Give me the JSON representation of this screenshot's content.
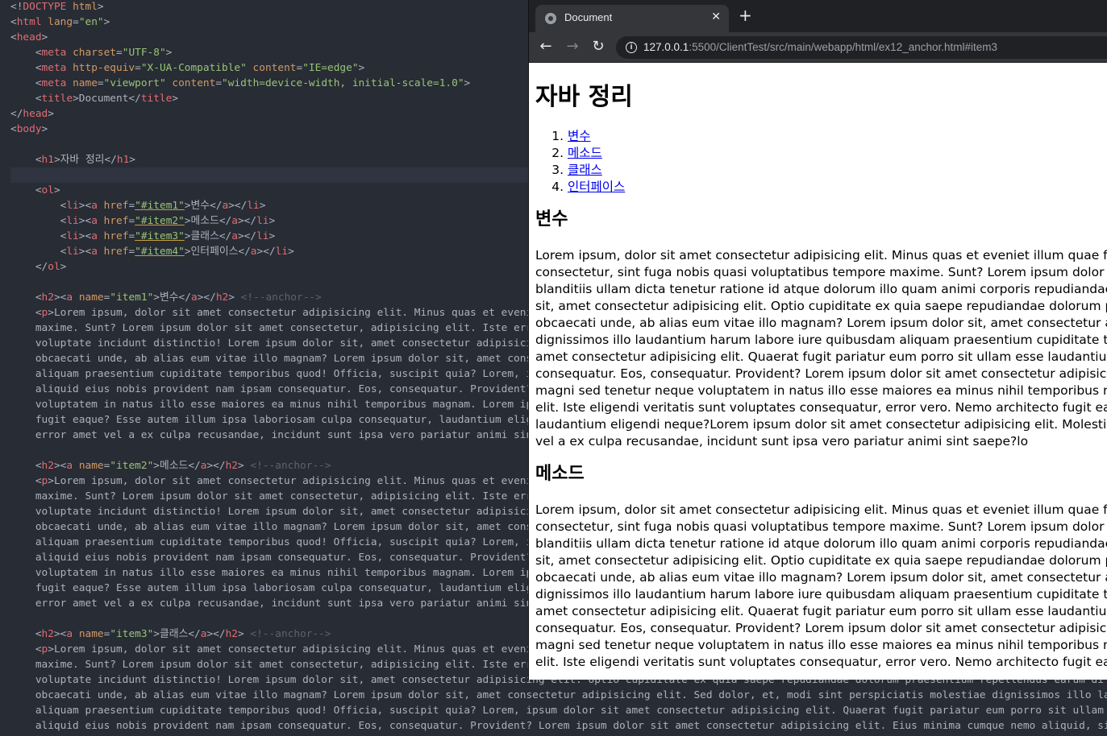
{
  "editor": {
    "lines": [
      [
        [
          "p",
          "<!"
        ],
        [
          "t",
          "DOCTYPE"
        ],
        [
          "p",
          " "
        ],
        [
          "a",
          "html"
        ],
        [
          "p",
          ">"
        ]
      ],
      [
        [
          "p",
          "<"
        ],
        [
          "t",
          "html"
        ],
        [
          "p",
          " "
        ],
        [
          "a",
          "lang"
        ],
        [
          "p",
          "="
        ],
        [
          "s",
          "\"en\""
        ],
        [
          "p",
          ">"
        ]
      ],
      [
        [
          "p",
          "<"
        ],
        [
          "t",
          "head"
        ],
        [
          "p",
          ">"
        ]
      ],
      [
        [
          "p",
          "    <"
        ],
        [
          "t",
          "meta"
        ],
        [
          "p",
          " "
        ],
        [
          "a",
          "charset"
        ],
        [
          "p",
          "="
        ],
        [
          "s",
          "\"UTF-8\""
        ],
        [
          "p",
          ">"
        ]
      ],
      [
        [
          "p",
          "    <"
        ],
        [
          "t",
          "meta"
        ],
        [
          "p",
          " "
        ],
        [
          "a",
          "http-equiv"
        ],
        [
          "p",
          "="
        ],
        [
          "s",
          "\"X-UA-Compatible\""
        ],
        [
          "p",
          " "
        ],
        [
          "a",
          "content"
        ],
        [
          "p",
          "="
        ],
        [
          "s",
          "\"IE=edge\""
        ],
        [
          "p",
          ">"
        ]
      ],
      [
        [
          "p",
          "    <"
        ],
        [
          "t",
          "meta"
        ],
        [
          "p",
          " "
        ],
        [
          "a",
          "name"
        ],
        [
          "p",
          "="
        ],
        [
          "s",
          "\"viewport\""
        ],
        [
          "p",
          " "
        ],
        [
          "a",
          "content"
        ],
        [
          "p",
          "="
        ],
        [
          "s",
          "\"width=device-width, initial-scale=1.0\""
        ],
        [
          "p",
          ">"
        ]
      ],
      [
        [
          "p",
          "    <"
        ],
        [
          "t",
          "title"
        ],
        [
          "p",
          ">Document</"
        ],
        [
          "t",
          "title"
        ],
        [
          "p",
          ">"
        ]
      ],
      [
        [
          "p",
          "</"
        ],
        [
          "t",
          "head"
        ],
        [
          "p",
          ">"
        ]
      ],
      [
        [
          "p",
          "<"
        ],
        [
          "t",
          "body"
        ],
        [
          "p",
          ">"
        ]
      ],
      [
        [
          "p",
          ""
        ]
      ],
      [
        [
          "p",
          "    <"
        ],
        [
          "t",
          "h1"
        ],
        [
          "p",
          ">자바 정리</"
        ],
        [
          "t",
          "h1"
        ],
        [
          "p",
          ">"
        ]
      ],
      [
        [
          "p",
          ""
        ]
      ],
      [
        [
          "p",
          "    <"
        ],
        [
          "t",
          "ol"
        ],
        [
          "p",
          ">"
        ]
      ],
      [
        [
          "p",
          "        <"
        ],
        [
          "t",
          "li"
        ],
        [
          "p",
          "><"
        ],
        [
          "t",
          "a"
        ],
        [
          "p",
          " "
        ],
        [
          "a",
          "href"
        ],
        [
          "p",
          "="
        ],
        [
          "s",
          "\"#item1\""
        ],
        [
          "p",
          ">변수</"
        ],
        [
          "t",
          "a"
        ],
        [
          "p",
          "></"
        ],
        [
          "t",
          "li"
        ],
        [
          "p",
          ">"
        ]
      ],
      [
        [
          "p",
          "        <"
        ],
        [
          "t",
          "li"
        ],
        [
          "p",
          "><"
        ],
        [
          "t",
          "a"
        ],
        [
          "p",
          " "
        ],
        [
          "a",
          "href"
        ],
        [
          "p",
          "="
        ],
        [
          "s",
          "\"#item2\""
        ],
        [
          "p",
          ">메소드</"
        ],
        [
          "t",
          "a"
        ],
        [
          "p",
          "></"
        ],
        [
          "t",
          "li"
        ],
        [
          "p",
          ">"
        ]
      ],
      [
        [
          "p",
          "        <"
        ],
        [
          "t",
          "li"
        ],
        [
          "p",
          "><"
        ],
        [
          "t",
          "a"
        ],
        [
          "p",
          " "
        ],
        [
          "a",
          "href"
        ],
        [
          "p",
          "="
        ],
        [
          "s",
          "\"#item3\""
        ],
        [
          "p",
          ">클래스</"
        ],
        [
          "t",
          "a"
        ],
        [
          "p",
          "></"
        ],
        [
          "t",
          "li"
        ],
        [
          "p",
          ">"
        ]
      ],
      [
        [
          "p",
          "        <"
        ],
        [
          "t",
          "li"
        ],
        [
          "p",
          "><"
        ],
        [
          "t",
          "a"
        ],
        [
          "p",
          " "
        ],
        [
          "a",
          "href"
        ],
        [
          "p",
          "="
        ],
        [
          "s",
          "\"#item4\""
        ],
        [
          "p",
          ">인터페이스</"
        ],
        [
          "t",
          "a"
        ],
        [
          "p",
          "></"
        ],
        [
          "t",
          "li"
        ],
        [
          "p",
          ">"
        ]
      ],
      [
        [
          "p",
          "    </"
        ],
        [
          "t",
          "ol"
        ],
        [
          "p",
          ">"
        ]
      ],
      [
        [
          "p",
          ""
        ]
      ],
      [
        [
          "p",
          "    <"
        ],
        [
          "t",
          "h2"
        ],
        [
          "p",
          "><"
        ],
        [
          "t",
          "a"
        ],
        [
          "p",
          " "
        ],
        [
          "a",
          "name"
        ],
        [
          "p",
          "="
        ],
        [
          "s",
          "\"item1\""
        ],
        [
          "p",
          ">변수</"
        ],
        [
          "t",
          "a"
        ],
        [
          "p",
          "></"
        ],
        [
          "t",
          "h2"
        ],
        [
          "p",
          "> "
        ],
        [
          "c",
          "<!--anchor-->"
        ]
      ],
      [
        [
          "p",
          "    <"
        ],
        [
          "t",
          "p"
        ],
        [
          "p",
          ">Lorem ipsum, dolor sit amet consectetur adipisicing elit. Minus quas et eveniet illum quae fugit totam qu"
        ]
      ],
      [
        [
          "p",
          "    maxime. Sunt? Lorem ipsum dolor sit amet consectetur, adipisicing elit. Iste error eveniet tempor"
        ]
      ],
      [
        [
          "p",
          "    voluptate incidunt distinctio! Lorem ipsum dolor sit, amet consectetur adipisicing elit. Optio cu"
        ]
      ],
      [
        [
          "p",
          "    obcaecati unde, ab alias eum vitae illo magnam? Lorem ipsum dolor sit, amet consectetur adipisic"
        ]
      ],
      [
        [
          "p",
          "    aliquam praesentium cupiditate temporibus quod! Officia, suscipit quia? Lorem, ipsum dolor sit"
        ]
      ],
      [
        [
          "p",
          "    aliquid eius nobis provident nam ipsam consequatur. Eos, consequatur. Provident? Lorem ipsum dolor"
        ]
      ],
      [
        [
          "p",
          "    voluptatem in natus illo esse maiores ea minus nihil temporibus magnam. Lorem ipsum dolor sit"
        ]
      ],
      [
        [
          "p",
          "    fugit eaque? Esse autem illum ipsa laboriosam culpa consequatur, laudantium eligendi neque?Lorem"
        ]
      ],
      [
        [
          "p",
          "    error amet vel a ex culpa recusandae, incidunt sunt ipsa vero pariatur animi sint saepe?lo"
        ]
      ],
      [
        [
          "p",
          ""
        ]
      ],
      [
        [
          "p",
          "    <"
        ],
        [
          "t",
          "h2"
        ],
        [
          "p",
          "><"
        ],
        [
          "t",
          "a"
        ],
        [
          "p",
          " "
        ],
        [
          "a",
          "name"
        ],
        [
          "p",
          "="
        ],
        [
          "s",
          "\"item2\""
        ],
        [
          "p",
          ">메소드</"
        ],
        [
          "t",
          "a"
        ],
        [
          "p",
          "></"
        ],
        [
          "t",
          "h2"
        ],
        [
          "p",
          "> "
        ],
        [
          "c",
          "<!--anchor-->"
        ]
      ],
      [
        [
          "p",
          "    <"
        ],
        [
          "t",
          "p"
        ],
        [
          "p",
          ">Lorem ipsum, dolor sit amet consectetur adipisicing elit. Minus quas et eveniet illum quae fugit totam qu"
        ]
      ],
      [
        [
          "p",
          "    maxime. Sunt? Lorem ipsum dolor sit amet consectetur, adipisicing elit. Iste error eveniet tempor"
        ]
      ],
      [
        [
          "p",
          "    voluptate incidunt distinctio! Lorem ipsum dolor sit, amet consectetur adipisicing elit. Optio cu"
        ]
      ],
      [
        [
          "p",
          "    obcaecati unde, ab alias eum vitae illo magnam? Lorem ipsum dolor sit, amet consectetur adipisic"
        ]
      ],
      [
        [
          "p",
          "    aliquam praesentium cupiditate temporibus quod! Officia, suscipit quia? Lorem, ipsum dolor sit"
        ]
      ],
      [
        [
          "p",
          "    aliquid eius nobis provident nam ipsam consequatur. Eos, consequatur. Provident? Lorem ipsum dolor"
        ]
      ],
      [
        [
          "p",
          "    voluptatem in natus illo esse maiores ea minus nihil temporibus magnam. Lorem ipsum dolor sit"
        ]
      ],
      [
        [
          "p",
          "    fugit eaque? Esse autem illum ipsa laboriosam culpa consequatur, laudantium eligendi neque?Lorem"
        ]
      ],
      [
        [
          "p",
          "    error amet vel a ex culpa recusandae, incidunt sunt ipsa vero pariatur animi sint saepe?lo"
        ]
      ],
      [
        [
          "p",
          ""
        ]
      ],
      [
        [
          "p",
          "    <"
        ],
        [
          "t",
          "h2"
        ],
        [
          "p",
          "><"
        ],
        [
          "t",
          "a"
        ],
        [
          "p",
          " "
        ],
        [
          "a",
          "name"
        ],
        [
          "p",
          "="
        ],
        [
          "s",
          "\"item3\""
        ],
        [
          "p",
          ">클래스</"
        ],
        [
          "t",
          "a"
        ],
        [
          "p",
          "></"
        ],
        [
          "t",
          "h2"
        ],
        [
          "p",
          "> "
        ],
        [
          "c",
          "<!--anchor-->"
        ]
      ],
      [
        [
          "p",
          "    <"
        ],
        [
          "t",
          "p"
        ],
        [
          "p",
          ">Lorem ipsum, dolor sit amet consectetur adipisicing elit. Minus quas et eveniet illum quae fugit totam qu"
        ]
      ],
      [
        [
          "p",
          "    maxime. Sunt? Lorem ipsum dolor sit amet consectetur, adipisicing elit. Iste error eveniet tempor"
        ]
      ],
      [
        [
          "p",
          "    voluptate incidunt distinctio! Lorem ipsum dolor sit, amet consectetur adipisicing elit. Optio cupiditate ex quia saepe repudiandae dolorum praesentium repellendus earum di"
        ]
      ],
      [
        [
          "p",
          "    obcaecati unde, ab alias eum vitae illo magnam? Lorem ipsum dolor sit, amet consectetur adipisicing elit. Sed dolor, et, modi sint perspiciatis molestiae dignissimos illo la"
        ]
      ],
      [
        [
          "p",
          "    aliquam praesentium cupiditate temporibus quod! Officia, suscipit quia? Lorem, ipsum dolor sit amet consectetur adipisicing elit. Quaerat fugit pariatur eum porro sit ullam"
        ]
      ],
      [
        [
          "p",
          "    aliquid eius nobis provident nam ipsam consequatur. Eos, consequatur. Provident? Lorem ipsum dolor sit amet consectetur adipisicing elit. Eius minima cumque nemo aliquid, si"
        ]
      ]
    ],
    "underlined_hrefs": [
      "\"#item1\"",
      "\"#item2\"",
      "\"#item3\"",
      "\"#item4\""
    ],
    "current_line_index": 11
  },
  "browser": {
    "tab_title": "Document",
    "tab_close": "✕",
    "new_tab": "+",
    "back": "←",
    "forward": "→",
    "reload": "↻",
    "info": "i",
    "url_host": "127.0.0.1",
    "url_rest": ":5500/ClientTest/src/main/webapp/html/ex12_anchor.html#item3"
  },
  "page": {
    "h1": "자바 정리",
    "toc": [
      "변수",
      "메소드",
      "클래스",
      "인터페이스"
    ],
    "section1_title": "변수",
    "section1_lines": [
      "Lorem ipsum, dolor sit amet consectetur adipisicing elit. Minus quas et eveniet illum quae fugit t",
      "consectetur, sint fuga nobis quasi voluptatibus tempore maxime. Sunt? Lorem ipsum dolor sit am",
      "blanditiis ullam dicta tenetur ratione id atque dolorum illo quam animi corporis repudiandae, ear",
      "sit, amet consectetur adipisicing elit. Optio cupiditate ex quia saepe repudiandae dolorum praese",
      "obcaecati unde, ab alias eum vitae illo magnam? Lorem ipsum dolor sit, amet consectetur adipisi",
      "dignissimos illo laudantium harum labore iure quibusdam aliquam praesentium cupiditate tempo",
      "amet consectetur adipisicing elit. Quaerat fugit pariatur eum porro sit ullam esse laudantium, mo",
      "consequatur. Eos, consequatur. Provident? Lorem ipsum dolor sit amet consectetur adipisicing eli",
      "magni sed tenetur neque voluptatem in natus illo esse maiores ea minus nihil temporibus magna",
      "elit. Iste eligendi veritatis sunt voluptates consequatur, error vero. Nemo architecto fugit eaque? E",
      "laudantium eligendi neque?Lorem ipsum dolor sit amet consectetur adipisicing elit. Molestiae ter",
      "vel a ex culpa recusandae, incidunt sunt ipsa vero pariatur animi sint saepe?lo"
    ],
    "section2_title": "메소드",
    "section2_lines": [
      "Lorem ipsum, dolor sit amet consectetur adipisicing elit. Minus quas et eveniet illum quae fugit t",
      "consectetur, sint fuga nobis quasi voluptatibus tempore maxime. Sunt? Lorem ipsum dolor sit am",
      "blanditiis ullam dicta tenetur ratione id atque dolorum illo quam animi corporis repudiandae, ear",
      "sit, amet consectetur adipisicing elit. Optio cupiditate ex quia saepe repudiandae dolorum praese",
      "obcaecati unde, ab alias eum vitae illo magnam? Lorem ipsum dolor sit, amet consectetur adipisi",
      "dignissimos illo laudantium harum labore iure quibusdam aliquam praesentium cupiditate tempo",
      "amet consectetur adipisicing elit. Quaerat fugit pariatur eum porro sit ullam esse laudantium, mo",
      "consequatur. Eos, consequatur. Provident? Lorem ipsum dolor sit amet consectetur adipisicing elit",
      "magni sed tenetur neque voluptatem in natus illo esse maiores ea minus nihil temporibus magna",
      "elit. Iste eligendi veritatis sunt voluptates consequatur, error vero. Nemo architecto fugit eaque?"
    ]
  },
  "colors": {
    "editor_bg": "#282c34",
    "tag": "#e06c75",
    "attr": "#d19a66",
    "string": "#98c379",
    "comment": "#5c6370",
    "link": "#0000ee",
    "chrome_tabstrip": "#202124",
    "chrome_toolbar": "#35363a"
  }
}
